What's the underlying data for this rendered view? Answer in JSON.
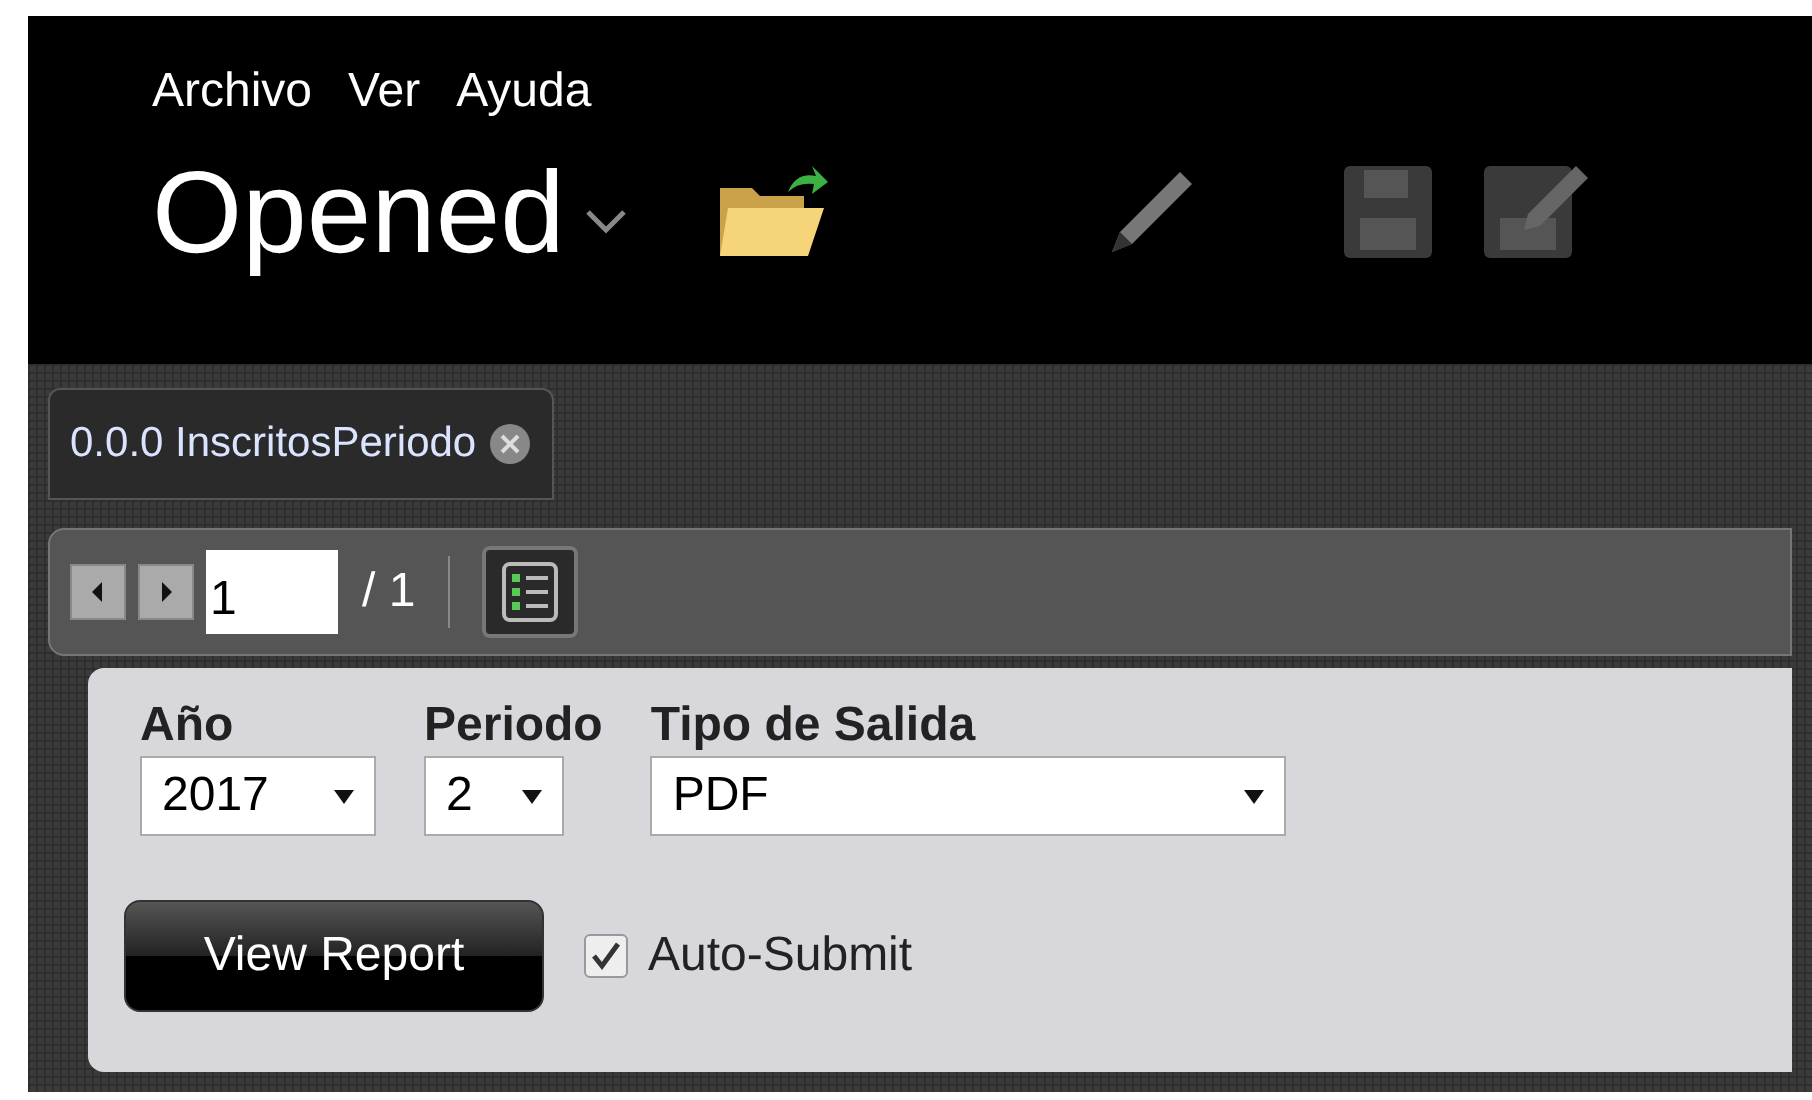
{
  "menu": [
    "Archivo",
    "Ver",
    "Ayuda"
  ],
  "title": "Opened",
  "tabs": [
    {
      "label": "0.0.0 InscritosPeriodo",
      "selected": true
    }
  ],
  "pager": {
    "page": "1",
    "total": "/ 1"
  },
  "params": [
    {
      "label": "Año",
      "value": "2017"
    },
    {
      "label": "Periodo",
      "value": "2"
    },
    {
      "label": "Tipo de Salida",
      "value": "PDF"
    }
  ],
  "view_button": "View Report",
  "auto_submit": {
    "label": "Auto-Submit",
    "checked": true
  }
}
